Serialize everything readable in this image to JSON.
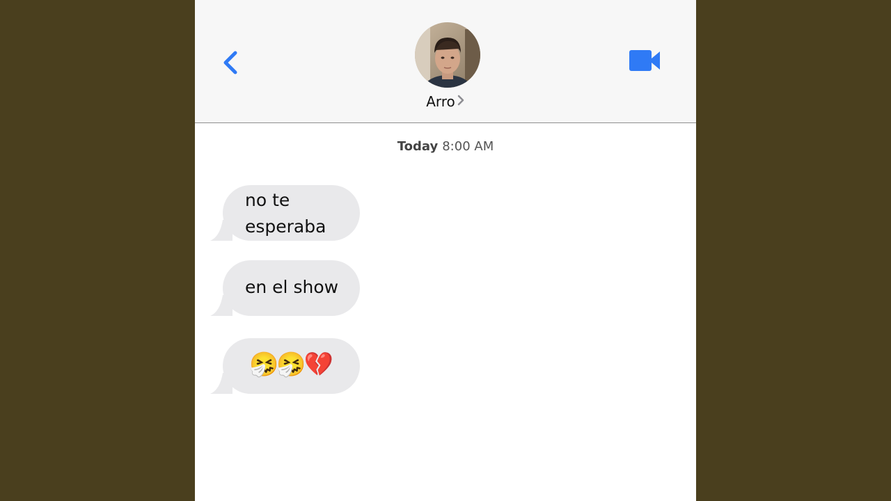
{
  "header": {
    "contact_name": "Arro",
    "back_icon": "chevron-left-icon",
    "video_icon": "video-camera-icon",
    "accent_color": "#2f7af5"
  },
  "timestamp": {
    "day": "Today",
    "time": "8:00 AM"
  },
  "messages": [
    {
      "text_line1": "no te",
      "text_line2": "esperaba",
      "direction": "incoming"
    },
    {
      "text": "en el show",
      "direction": "incoming"
    },
    {
      "emojis": [
        "🤧",
        "🤧",
        "💔"
      ],
      "direction": "incoming"
    }
  ],
  "colors": {
    "background": "#4a3f1e",
    "bubble_incoming": "#e9e9eb",
    "header_bg": "#f7f7f7"
  }
}
